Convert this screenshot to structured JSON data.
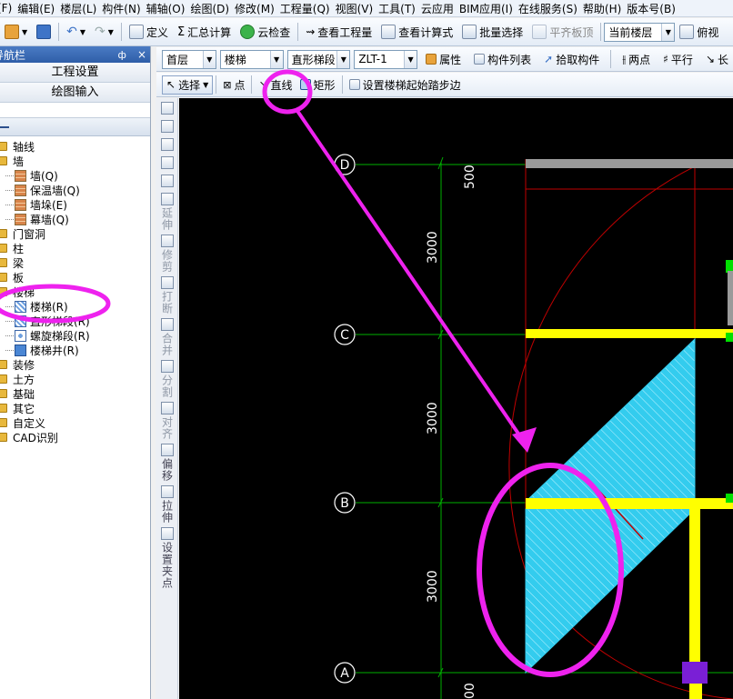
{
  "menu": {
    "items": [
      "(F)",
      "编辑(E)",
      "楼层(L)",
      "构件(N)",
      "辅轴(O)",
      "绘图(D)",
      "修改(M)",
      "工程量(Q)",
      "视图(V)",
      "工具(T)",
      "云应用",
      "BIM应用(I)",
      "在线服务(S)",
      "帮助(H)",
      "版本号(B)"
    ]
  },
  "toolbar1": {
    "define": "定义",
    "sum_calc": "汇总计算",
    "cloud_check": "云检查",
    "view_quantity": "查看工程量",
    "view_formula": "查看计算式",
    "batch_select": "批量选择",
    "flush_slab_top": "平齐板顶",
    "floor_select": "当前楼层",
    "top_view": "俯视"
  },
  "nav": {
    "title": "导航栏",
    "pin": "ф",
    "close": "×",
    "project_settings": "工程设置",
    "drawing_input": "绘图输入",
    "tree": [
      {
        "label": "轴线",
        "level": 0
      },
      {
        "label": "墙",
        "level": 0
      },
      {
        "label": "墙(Q)",
        "level": 1,
        "icon": "wall"
      },
      {
        "label": "保温墙(Q)",
        "level": 1,
        "icon": "wall"
      },
      {
        "label": "墙垛(E)",
        "level": 1,
        "icon": "wall"
      },
      {
        "label": "幕墙(Q)",
        "level": 1,
        "icon": "wall"
      },
      {
        "label": "门窗洞",
        "level": 0
      },
      {
        "label": "柱",
        "level": 0
      },
      {
        "label": "梁",
        "level": 0
      },
      {
        "label": "板",
        "level": 0
      },
      {
        "label": "楼梯",
        "level": 0
      },
      {
        "label": "楼梯(R)",
        "level": 1,
        "icon": "stair"
      },
      {
        "label": "直形梯段(R)",
        "level": 1,
        "icon": "stair"
      },
      {
        "label": "螺旋梯段(R)",
        "level": 1,
        "icon": "spiral"
      },
      {
        "label": "楼梯井(R)",
        "level": 1,
        "icon": "well"
      },
      {
        "label": "装修",
        "level": 0
      },
      {
        "label": "土方",
        "level": 0
      },
      {
        "label": "基础",
        "level": 0
      },
      {
        "label": "其它",
        "level": 0
      },
      {
        "label": "自定义",
        "level": 0
      },
      {
        "label": "CAD识别",
        "level": 0
      }
    ]
  },
  "toolbar2": {
    "floor": "首层",
    "category": "楼梯",
    "type": "直形梯段",
    "component": "ZLT-1",
    "properties": "属性",
    "component_list": "构件列表",
    "pick_component": "拾取构件",
    "two_points": "两点",
    "parallel": "平行",
    "long": "长"
  },
  "toolbar3": {
    "select": "选择",
    "point": "点",
    "line": "直线",
    "rectangle": "矩形",
    "set_start_edge": "设置楼梯起始踏步边"
  },
  "vtools": [
    "延伸",
    "修剪",
    "打断",
    "合并",
    "分割",
    "对齐",
    "偏移",
    "拉伸",
    "设置夹点"
  ],
  "canvas": {
    "axis_labels": [
      "D",
      "C",
      "B",
      "A"
    ],
    "dims": [
      "500",
      "3000",
      "3000",
      "3000",
      "00"
    ],
    "colors": {
      "background": "#000000",
      "grid": "#00c000",
      "beam": "#ffff00",
      "stair": "#33ccee",
      "arc": "#c00000",
      "annotation": "#ee22ee"
    }
  }
}
